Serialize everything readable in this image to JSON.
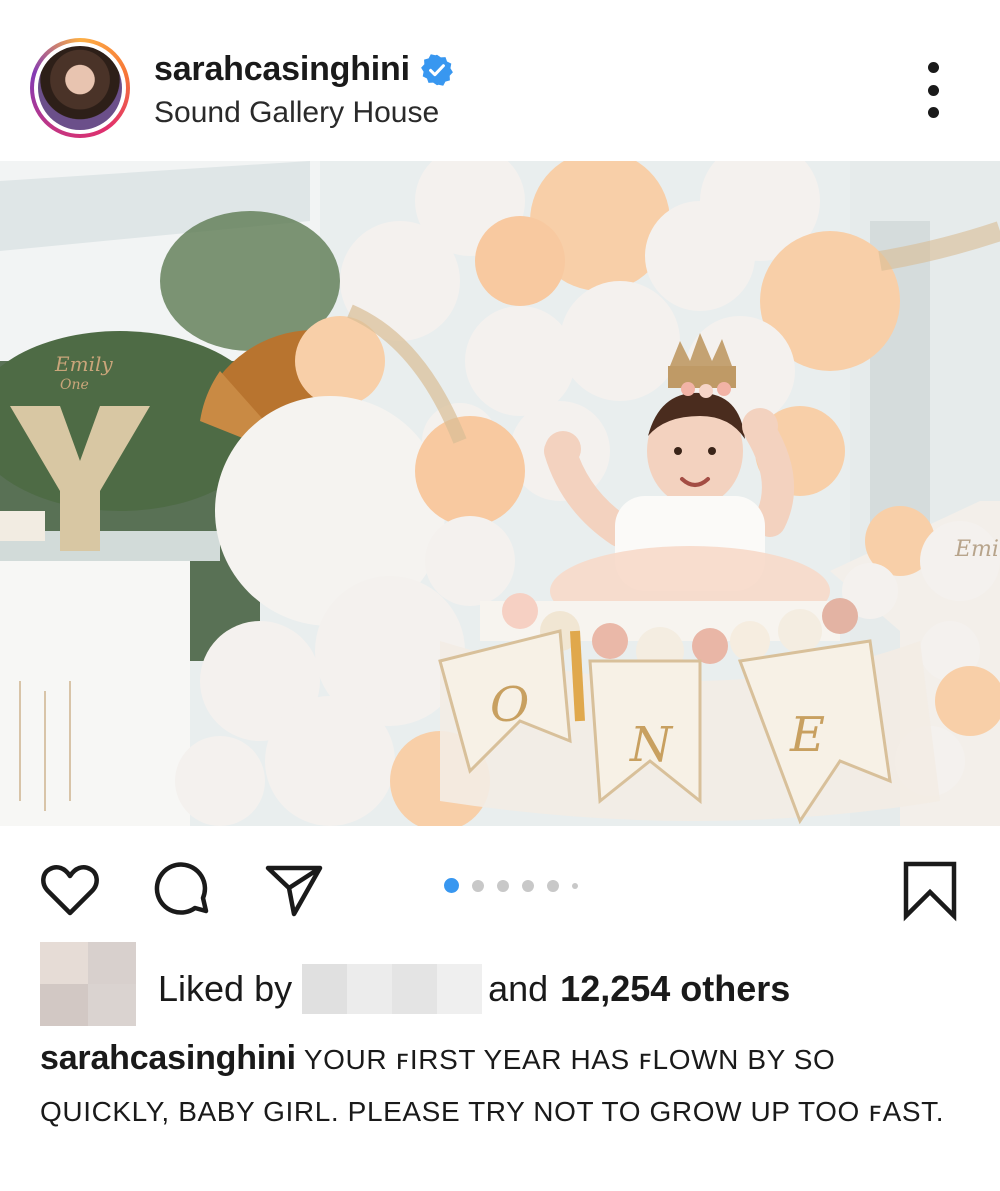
{
  "post": {
    "username": "sarahcasinghini",
    "verified": true,
    "location": "Sound Gallery House",
    "carousel": {
      "count": 6,
      "active_index": 0
    }
  },
  "image": {
    "alt_text_visible": "",
    "cake_topper_text": "Emily One",
    "banner_letters": [
      "O",
      "N",
      "E"
    ],
    "marquee_letter": "Y",
    "balloon_text": "Emily"
  },
  "likes": {
    "prefix": "Liked by",
    "middle": "and",
    "count_text": "12,254 others"
  },
  "caption": {
    "username": "sarahcasinghini",
    "text": "YOUR ꜰIRST YEAR HAS ꜰLOWN BY SO QUICKLY, BABY GIRL. PLEASE TRY NOT TO GROW UP TOO ꜰAST."
  },
  "icons": {
    "like": "heart-icon",
    "comment": "comment-icon",
    "share": "send-icon",
    "save": "bookmark-icon",
    "more": "more-options-icon",
    "verified": "verified-badge-icon"
  },
  "colors": {
    "verified_blue": "#3897f0",
    "carousel_active": "#3897f0",
    "carousel_inactive": "#c8c8c8",
    "peach_balloon": "#f8cfa8",
    "white_balloon": "#f4f1ee"
  }
}
